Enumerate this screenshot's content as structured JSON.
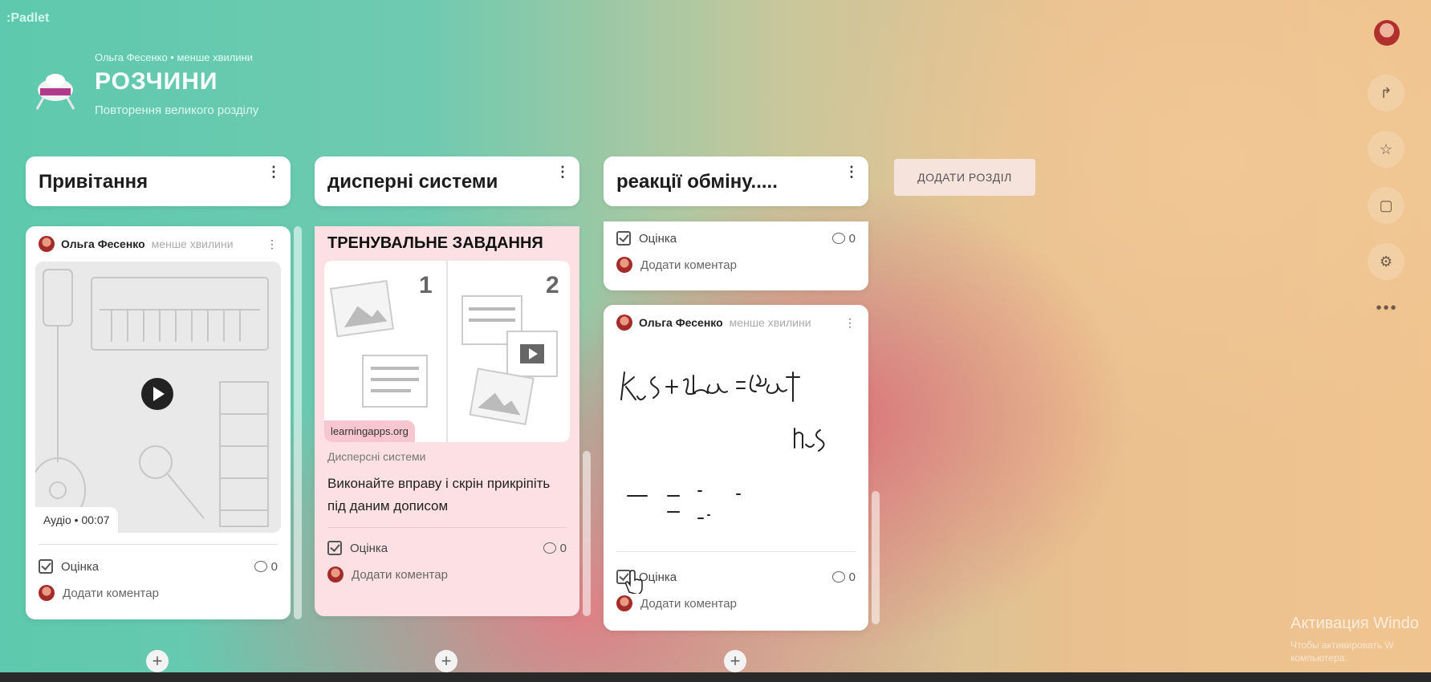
{
  "app": {
    "logo": ":Padlet"
  },
  "board": {
    "meta": "Ольга Фесенко • менше хвилини",
    "title": "РОЗЧИНИ",
    "subtitle": "Повторення великого розділу"
  },
  "sections": [
    {
      "title": "Привітання"
    },
    {
      "title": "дисперні системи"
    },
    {
      "title": "реакції обміну....."
    }
  ],
  "add_section_label": "ДОДАТИ РОЗДІЛ",
  "posts": {
    "audio": {
      "author": "Ольга Фесенко",
      "time": "менше хвилини",
      "audio_label": "Аудіо • 00:07",
      "rating_label": "Оцінка",
      "comment_count": "0",
      "add_comment": "Додати коментар"
    },
    "task": {
      "title": "ТРЕНУВАЛЬНЕ ЗАВДАННЯ",
      "num1": "1",
      "num2": "2",
      "link_label": "learningapps.org",
      "link_title": "Дисперсні системи",
      "body": "Виконайте вправу і скрін прикріпіть під даним дописом",
      "rating_label": "Оцінка",
      "comment_count": "0",
      "add_comment": "Додати коментар"
    },
    "prev": {
      "rating_label": "Оцінка",
      "comment_count": "0",
      "add_comment": "Додати коментар"
    },
    "drawing": {
      "author": "Ольга Фесенко",
      "time": "менше хвилини",
      "rating_label": "Оцінка",
      "comment_count": "0",
      "add_comment": "Додати коментар"
    }
  },
  "watermark": {
    "line1": "Активация Windo",
    "line2": "Чтобы активировать W компьютера."
  },
  "colors": {
    "accent_pink": "#fde0e3",
    "teal": "#5ec9ae",
    "peach": "#f1c48f"
  }
}
